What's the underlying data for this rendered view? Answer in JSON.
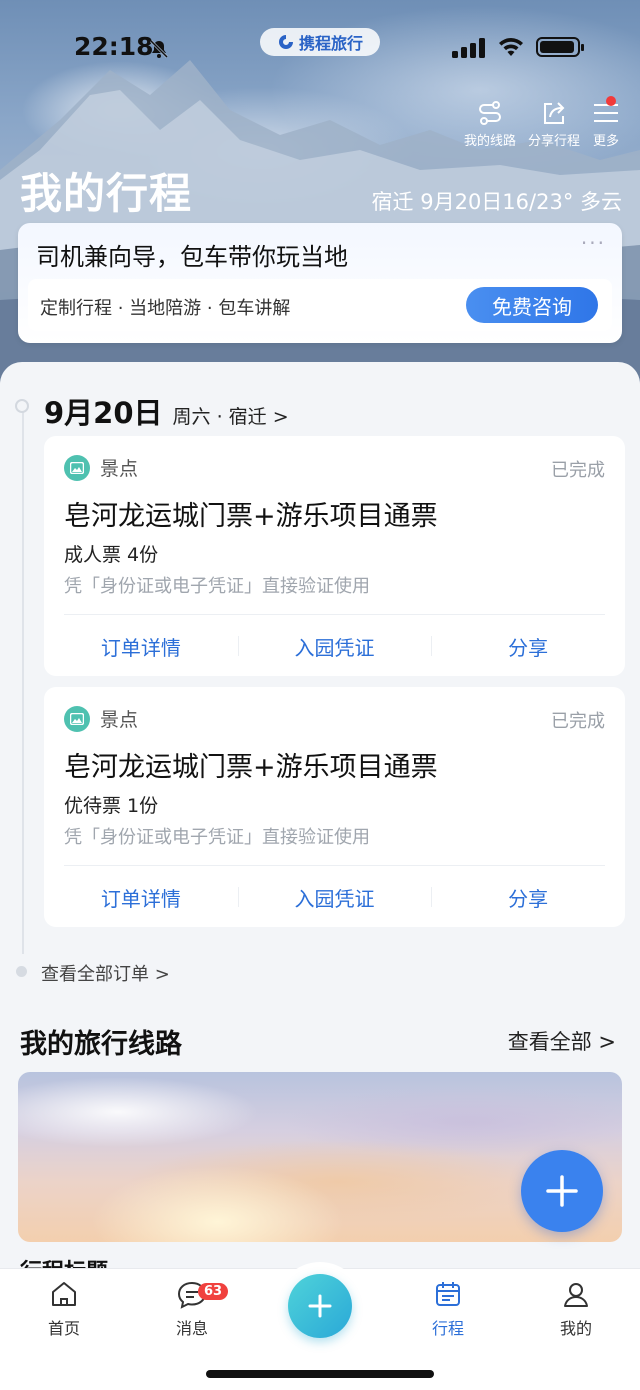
{
  "status_bar": {
    "time": "22:18"
  },
  "brand": {
    "name": "携程旅行"
  },
  "top_actions": [
    {
      "label": "我的线路",
      "icon": "route-icon"
    },
    {
      "label": "分享行程",
      "icon": "share-icon"
    },
    {
      "label": "更多",
      "icon": "menu-icon"
    }
  ],
  "header": {
    "title": "我的行程",
    "weather": "宿迁 9月20日16/23° 多云"
  },
  "promo": {
    "title": "司机兼向导，包车带你玩当地",
    "more": "···",
    "subtitle": "定制行程 · 当地陪游 · 包车讲解",
    "button": "免费咨询"
  },
  "day": {
    "date": "9月20日",
    "detail": "周六 · 宿迁 >"
  },
  "orders": [
    {
      "category": "景点",
      "status": "已完成",
      "title": "皂河龙运城门票+游乐项目通票",
      "quantity": "成人票 4份",
      "hint": "凭「身份证或电子凭证」直接验证使用",
      "actions": [
        "订单详情",
        "入园凭证",
        "分享"
      ]
    },
    {
      "category": "景点",
      "status": "已完成",
      "title": "皂河龙运城门票+游乐项目通票",
      "quantity": "优待票 1份",
      "hint": "凭「身份证或电子凭证」直接验证使用",
      "actions": [
        "订单详情",
        "入园凭证",
        "分享"
      ]
    }
  ],
  "view_all_orders": "查看全部订单 >",
  "routes_section": {
    "title": "我的旅行线路",
    "more": "查看全部 >",
    "card_title": "行程标题"
  },
  "tabbar": {
    "items": [
      {
        "label": "首页",
        "icon": "home-icon"
      },
      {
        "label": "消息",
        "icon": "message-icon",
        "badge": "63"
      },
      {
        "label": "行程",
        "icon": "itinerary-icon"
      },
      {
        "label": "我的",
        "icon": "profile-icon"
      }
    ],
    "active": "行程"
  },
  "colors": {
    "accent": "#2c6fd8",
    "fab": "#3a82ee",
    "badge": "#f0413e",
    "category": "#4fc1b0"
  }
}
